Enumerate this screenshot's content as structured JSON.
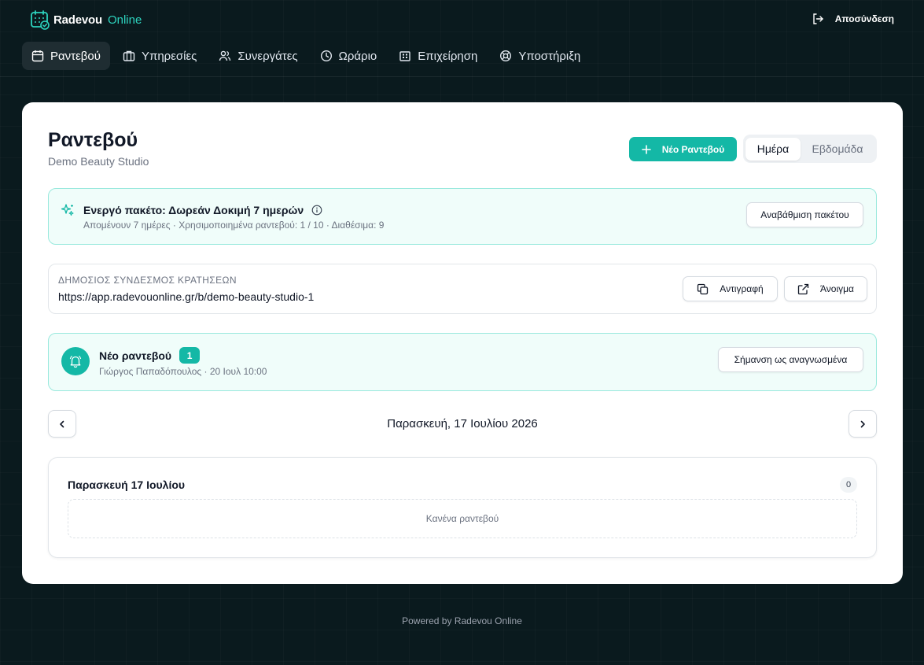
{
  "brand": {
    "name": "Radevou",
    "sub": "Online"
  },
  "header": {
    "logout_label": "Αποσύνδεση"
  },
  "nav": [
    {
      "label": "Ραντεβού",
      "icon": "calendar-icon",
      "active": true
    },
    {
      "label": "Υπηρεσίες",
      "icon": "briefcase-icon",
      "active": false
    },
    {
      "label": "Συνεργάτες",
      "icon": "users-icon",
      "active": false
    },
    {
      "label": "Ωράριο",
      "icon": "clock-icon",
      "active": false
    },
    {
      "label": "Επιχείρηση",
      "icon": "building-icon",
      "active": false
    },
    {
      "label": "Υποστήριξη",
      "icon": "lifebuoy-icon",
      "active": false
    }
  ],
  "page": {
    "title": "Ραντεβού",
    "subtitle": "Demo Beauty Studio",
    "new_button": "Νέο Ραντεβού",
    "view_toggle": {
      "day": "Ημέρα",
      "week": "Εβδομάδα",
      "selected": "day"
    }
  },
  "plan": {
    "title": "Ενεργό πακέτο: Δωρεάν Δοκιμή 7 ημερών",
    "meta": "Απομένουν 7 ημέρες · Χρησιμοποιημένα ραντεβού: 1 / 10 · Διαθέσιμα: 9",
    "upgrade_label": "Αναβάθμιση πακέτου"
  },
  "public_link": {
    "label": "ΔΗΜΟΣΙΟΣ ΣΥΝΔΕΣΜΟΣ ΚΡΑΤΗΣΕΩΝ",
    "url": "https://app.radevouonline.gr/b/demo-beauty-studio-1",
    "copy_label": "Αντιγραφή",
    "open_label": "Άνοιγμα"
  },
  "notification": {
    "title": "Νέο ραντεβού",
    "count": "1",
    "meta": "Γιώργος Παπαδόπουλος · 20 Ιουλ 10:00",
    "mark_read_label": "Σήμανση ως αναγνωσμένα"
  },
  "date_nav": {
    "current": "Παρασκευή, 17 Ιουλίου 2026"
  },
  "day": {
    "title": "Παρασκευή 17 Ιουλίου",
    "count": "0",
    "empty_text": "Κανένα ραντεβού"
  },
  "footer": {
    "text": "Powered by Radevou Online"
  },
  "colors": {
    "accent": "#14b8a6",
    "background": "#0a1a1e",
    "banner_bg": "#f0fdfa"
  }
}
